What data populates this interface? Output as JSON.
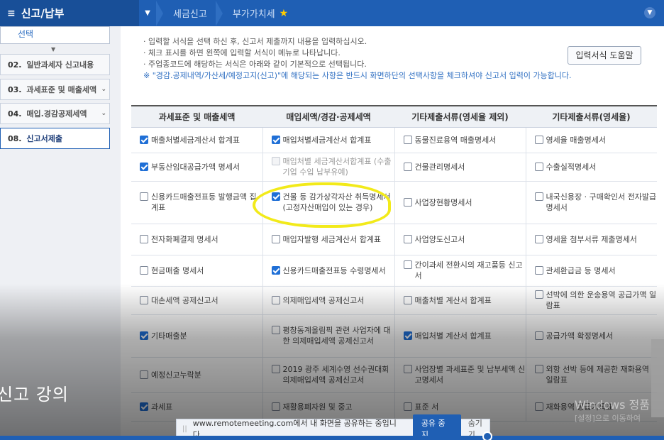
{
  "topbar": {
    "menu_label": "신고/납부",
    "breadcrumbs": [
      "세금신고",
      "부가가치세"
    ],
    "colors": {
      "bar": "#1f5fb4",
      "star": "#ffcc00"
    }
  },
  "sidebar": {
    "select_label": "선택",
    "items": [
      {
        "num": "02.",
        "label": "일반과세자 신고내용"
      },
      {
        "num": "03.",
        "label": "과세표준 및 매출세액"
      },
      {
        "num": "04.",
        "label": "매입.경감공제세액"
      },
      {
        "num": "08.",
        "label": "신고서제출"
      }
    ]
  },
  "notes": {
    "line1": "· 입력할 서식을 선택 하신 후, 신고서 제출까지 내용을 입력하십시오.",
    "line2": "· 체크 표시를 하면 왼쪽에 입력할 서식이 메뉴로 나타납니다.",
    "line3": "· 주업종코드에 해당하는 서식은 아래와 같이 기본적으로 선택됩니다.",
    "warning": "※ \"경감.공제내역/가산세/예정고지(신고)\"에 해당되는 사항은 반드시 화면하단의 선택사항을 체크하셔야 신고서 입력이 가능합니다."
  },
  "help_button": "입력서식 도움말",
  "table": {
    "headers": [
      "과세표준 및 매출세액",
      "매입세액/경감·공제세액",
      "기타제출서류(영세율 제외)",
      "기타제출서류(영세율)"
    ],
    "rows": [
      [
        {
          "label": "매출처별세금계산서 합계표",
          "checked": true
        },
        {
          "label": "매입처별세금계산서 합계표",
          "checked": true
        },
        {
          "label": "동물진료용역 매출명세서",
          "checked": false
        },
        {
          "label": "영세율 매출명세서",
          "checked": false
        }
      ],
      [
        {
          "label": "부동산임대공급가액 명세서",
          "checked": true
        },
        {
          "label": "매입처별 세금계산서합계표 (수출기업 수입 납부유예)",
          "checked": false,
          "disabled": true
        },
        {
          "label": "건물관리명세서",
          "checked": false
        },
        {
          "label": "수출실적명세서",
          "checked": false
        }
      ],
      [
        {
          "label": "신용카드매출전표등 발행금액 집계표",
          "checked": false
        },
        {
          "label": "건물 등 감가상각자산 취득명세서 (고정자산매입이 있는 경우)",
          "checked": true
        },
        {
          "label": "사업장현황명세서",
          "checked": false
        },
        {
          "label": "내국신용장 · 구매확인서 전자발급명세서",
          "checked": false
        }
      ],
      [
        {
          "label": "전자화폐결제 명세서",
          "checked": false
        },
        {
          "label": "매입자발행 세금계산서 합계표",
          "checked": false
        },
        {
          "label": "사업양도신고서",
          "checked": false
        },
        {
          "label": "영세율 첨부서류 제출명세서",
          "checked": false
        }
      ],
      [
        {
          "label": "현금매출 명세서",
          "checked": false
        },
        {
          "label": "신용카드매출전표등 수령명세서",
          "checked": true
        },
        {
          "label": "간이과세 전환시의 재고품등 신고서",
          "checked": false
        },
        {
          "label": "관세환급금 등 명세서",
          "checked": false
        }
      ],
      [
        {
          "label": "대손세액 공제신고서",
          "checked": false
        },
        {
          "label": "의제매입세액 공제신고서",
          "checked": false
        },
        {
          "label": "매출처별 계산서 합계표",
          "checked": false
        },
        {
          "label": "선박에 의한 운송용역 공급가액 일람표",
          "checked": false
        }
      ],
      [
        {
          "label": "기타매출분",
          "checked": true
        },
        {
          "label": "평창동계올림픽 관련 사업자에 대한 의제매입세액 공제신고서",
          "checked": false
        },
        {
          "label": "매입처별 계산서 합계표",
          "checked": true
        },
        {
          "label": "공급가액 확정명세서",
          "checked": false
        }
      ],
      [
        {
          "label": "예정신고누락분",
          "checked": false
        },
        {
          "label": "2019 광주 세계수영 선수권대회 의제매입세액 공제신고서",
          "checked": false
        },
        {
          "label": "사업장별 과세표준 및 납부세액 신고명세서",
          "checked": false
        },
        {
          "label": "외항 선박 등에 제공한 재화용역 일람표",
          "checked": false
        }
      ],
      [
        {
          "label": "과세표",
          "checked": true
        },
        {
          "label": "재활용폐자원 및 중고",
          "checked": false
        },
        {
          "label": "표준 서",
          "checked": false
        },
        {
          "label": "재화용역 공급기록표",
          "checked": false
        }
      ]
    ]
  },
  "overlay": {
    "lecture_text": "신고 강의",
    "windows_text": "Windows 정품",
    "windows_sub": "[설정]으로 이동하여",
    "share_text": "www.remotemeeting.com에서 내 화면을 공유하는 중입니다.",
    "share_stop": "공유 중지",
    "share_hide": "숨기기"
  }
}
